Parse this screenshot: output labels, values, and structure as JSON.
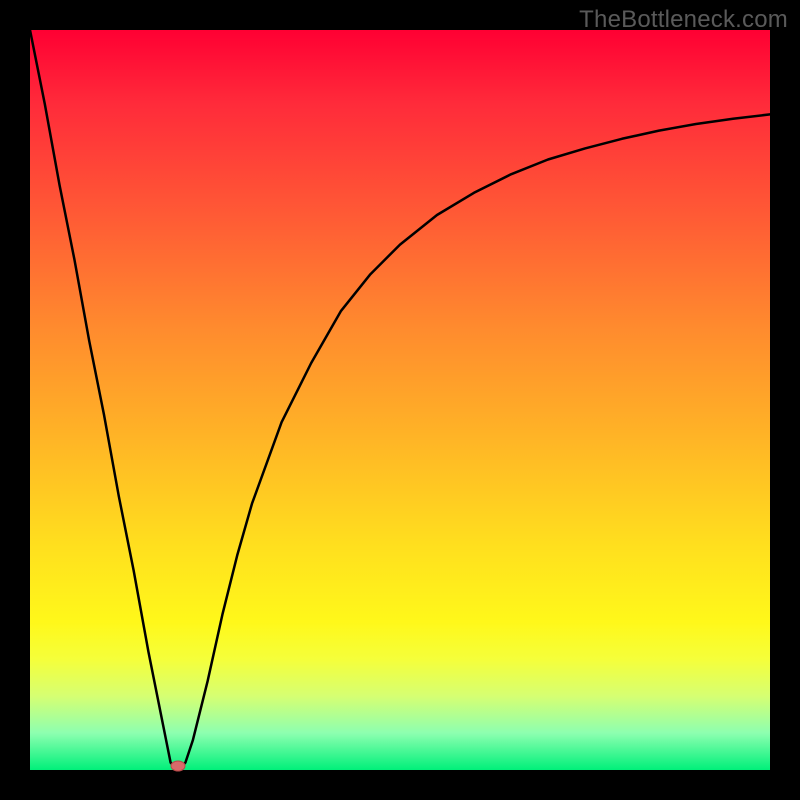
{
  "attribution": "TheBottleneck.com",
  "chart_data": {
    "type": "line",
    "title": "",
    "xlabel": "",
    "ylabel": "",
    "xlim": [
      0,
      100
    ],
    "ylim": [
      0,
      100
    ],
    "x": [
      0,
      2,
      4,
      6,
      8,
      10,
      12,
      14,
      16,
      18,
      19,
      20,
      21,
      22,
      24,
      26,
      28,
      30,
      34,
      38,
      42,
      46,
      50,
      55,
      60,
      65,
      70,
      75,
      80,
      85,
      90,
      95,
      100
    ],
    "values": [
      100,
      90,
      79,
      69,
      58,
      48,
      37,
      27,
      16,
      6,
      1,
      0,
      1,
      4,
      12,
      21,
      29,
      36,
      47,
      55,
      62,
      67,
      71,
      75,
      78,
      80.5,
      82.5,
      84,
      85.3,
      86.4,
      87.3,
      88,
      88.6
    ],
    "marker": {
      "x": 20,
      "y": 0
    },
    "gradient_stops": [
      {
        "pos": 0,
        "color": "#ff0033"
      },
      {
        "pos": 50,
        "color": "#ffb426"
      },
      {
        "pos": 80,
        "color": "#fff81a"
      },
      {
        "pos": 100,
        "color": "#00f07a"
      }
    ]
  }
}
